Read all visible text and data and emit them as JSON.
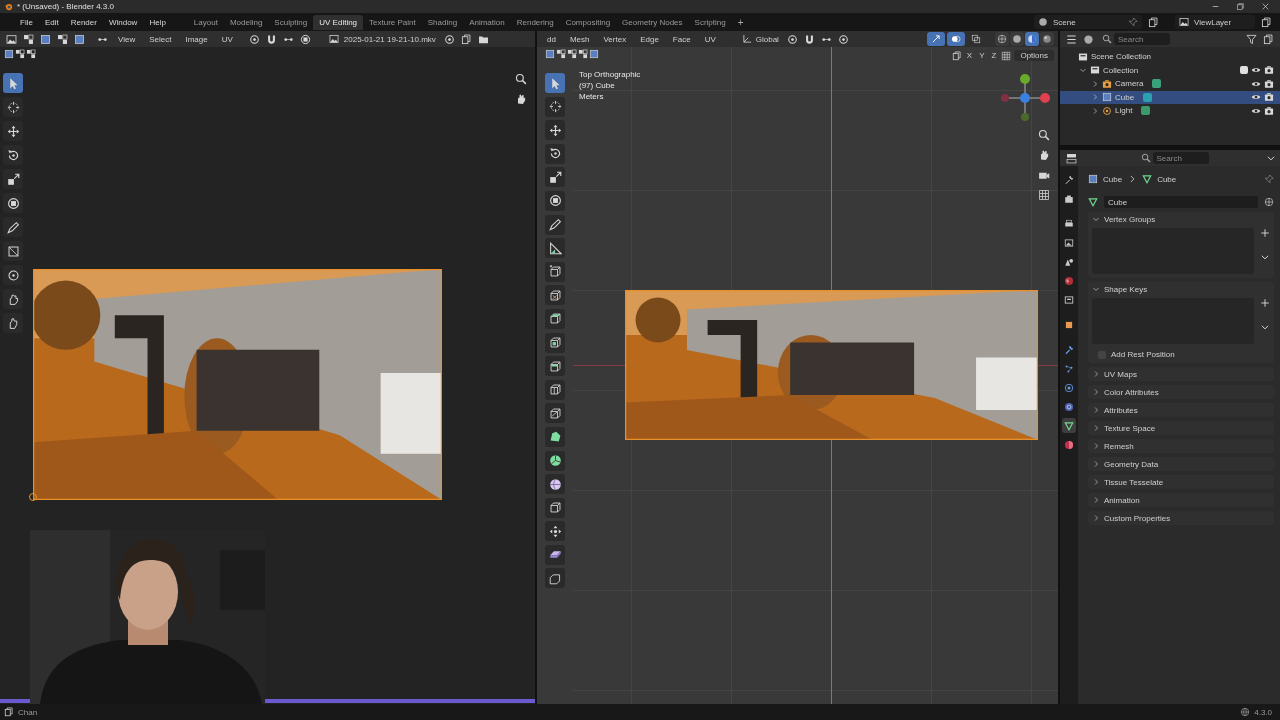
{
  "window": {
    "title": "* (Unsaved) - Blender 4.3.0"
  },
  "menu": [
    "File",
    "Edit",
    "Render",
    "Window",
    "Help"
  ],
  "workspaces": [
    {
      "label": "Layout",
      "selected": false
    },
    {
      "label": "Modeling",
      "selected": false
    },
    {
      "label": "Sculpting",
      "selected": false
    },
    {
      "label": "UV Editing",
      "selected": true
    },
    {
      "label": "Texture Paint",
      "selected": false
    },
    {
      "label": "Shading",
      "selected": false
    },
    {
      "label": "Animation",
      "selected": false
    },
    {
      "label": "Rendering",
      "selected": false
    },
    {
      "label": "Compositing",
      "selected": false
    },
    {
      "label": "Geometry Nodes",
      "selected": false
    },
    {
      "label": "Scripting",
      "selected": false
    }
  ],
  "add_workspace": "+",
  "scene": "Scene",
  "view_layer": "ViewLayer",
  "uv_editor": {
    "menus": [
      "View",
      "Select",
      "Image",
      "UV"
    ],
    "image_name": "2025-01-21 19-21-10.mkv",
    "image": {
      "kind": "picture"
    },
    "tools": [
      {
        "kind": "select",
        "selected": true
      },
      {
        "kind": "cursor",
        "selected": false
      },
      {
        "kind": "move",
        "selected": false
      },
      {
        "kind": "rotate",
        "selected": false
      },
      {
        "kind": "scale",
        "selected": false
      },
      {
        "kind": "transform",
        "selected": false
      },
      {
        "kind": "annotate",
        "selected": false
      },
      {
        "kind": "rip",
        "selected": false
      },
      {
        "kind": "grab",
        "selected": false
      },
      {
        "kind": "relax",
        "selected": false
      },
      {
        "kind": "pinch",
        "selected": false
      }
    ]
  },
  "webcam": {
    "kind": "picture"
  },
  "viewport": {
    "menus": [
      "dd",
      "Mesh",
      "Vertex",
      "Edge",
      "Face",
      "UV"
    ],
    "orientation": "Global",
    "axes": [
      "X",
      "Y",
      "Z"
    ],
    "options": "Options",
    "overlay": [
      "Top Orthographic",
      "(97) Cube",
      "Meters"
    ],
    "toggles": [
      {
        "kind": "gizmo",
        "on": true
      },
      {
        "kind": "overlay",
        "on": true
      },
      {
        "kind": "xray",
        "on": false
      }
    ],
    "shading": [
      {
        "kind": "wireframe",
        "selected": false
      },
      {
        "kind": "solid",
        "selected": false
      },
      {
        "kind": "material",
        "selected": true
      },
      {
        "kind": "rendered",
        "selected": false
      }
    ],
    "plane": {
      "kind": "picture"
    },
    "tools": [
      {
        "kind": "select",
        "selected": true
      },
      {
        "kind": "cursor",
        "selected": false
      },
      {
        "kind": "move",
        "selected": false
      },
      {
        "kind": "rotate",
        "selected": false
      },
      {
        "kind": "scale",
        "selected": false
      },
      {
        "kind": "transform",
        "selected": false
      },
      {
        "kind": "annotate",
        "selected": false
      },
      {
        "kind": "measure",
        "selected": false
      },
      {
        "kind": "add_cube",
        "selected": false
      },
      {
        "kind": "cut_cube",
        "selected": false
      },
      {
        "kind": "extrude",
        "selected": false
      },
      {
        "kind": "inset",
        "selected": false
      },
      {
        "kind": "bevel",
        "selected": false
      },
      {
        "kind": "loopcut",
        "selected": false
      },
      {
        "kind": "knife",
        "selected": false
      },
      {
        "kind": "polybuild",
        "selected": false
      },
      {
        "kind": "spin",
        "selected": false
      },
      {
        "kind": "smooth",
        "selected": false
      },
      {
        "kind": "edge_slide",
        "selected": false
      },
      {
        "kind": "shrink",
        "selected": false
      },
      {
        "kind": "shear",
        "selected": false
      },
      {
        "kind": "rip_cube",
        "selected": false
      }
    ]
  },
  "outliner": {
    "search_placeholder": "Search",
    "tree": [
      {
        "label": "Scene Collection",
        "kind": "scene",
        "selected": false,
        "children": [
          {
            "label": "Collection",
            "kind": "collection",
            "expanded": true,
            "checked": true,
            "selected": false,
            "children": [
              {
                "label": "Camera",
                "kind": "camera",
                "expanded": false,
                "selected": false
              },
              {
                "label": "Cube",
                "kind": "mesh",
                "expanded": false,
                "selected": true
              },
              {
                "label": "Light",
                "kind": "light",
                "expanded": false,
                "selected": false
              }
            ]
          }
        ]
      }
    ]
  },
  "properties": {
    "search_placeholder": "Search",
    "breadcrumb": [
      "Cube",
      "Cube"
    ],
    "mesh_name": "Cube",
    "tabs": [
      {
        "kind": "tool",
        "selected": false
      },
      {
        "kind": "render",
        "selected": false
      },
      {
        "kind": "output",
        "selected": false
      },
      {
        "kind": "view",
        "selected": false
      },
      {
        "kind": "scene",
        "selected": false
      },
      {
        "kind": "world",
        "selected": false
      },
      {
        "kind": "collection",
        "selected": false
      },
      {
        "kind": "object",
        "selected": false
      },
      {
        "kind": "modifiers",
        "selected": false
      },
      {
        "kind": "particles",
        "selected": false
      },
      {
        "kind": "physics",
        "selected": false
      },
      {
        "kind": "constraints",
        "selected": false
      },
      {
        "kind": "data",
        "selected": true
      },
      {
        "kind": "material",
        "selected": false
      }
    ],
    "panels": [
      {
        "label": "Vertex Groups",
        "expanded": true
      },
      {
        "label": "Shape Keys",
        "expanded": true,
        "option": {
          "label": "Add Rest Position",
          "checked": false
        }
      },
      {
        "label": "UV Maps",
        "expanded": false
      },
      {
        "label": "Color Attributes",
        "expanded": false
      },
      {
        "label": "Attributes",
        "expanded": false
      },
      {
        "label": "Texture Space",
        "expanded": false
      },
      {
        "label": "Remesh",
        "expanded": false
      },
      {
        "label": "Geometry Data",
        "expanded": false
      },
      {
        "label": "Tissue Tesselate",
        "expanded": false
      },
      {
        "label": "Animation",
        "expanded": false
      },
      {
        "label": "Custom Properties",
        "expanded": false
      }
    ]
  },
  "status_bar": {
    "left": "Chan",
    "version": "4.3.0"
  }
}
